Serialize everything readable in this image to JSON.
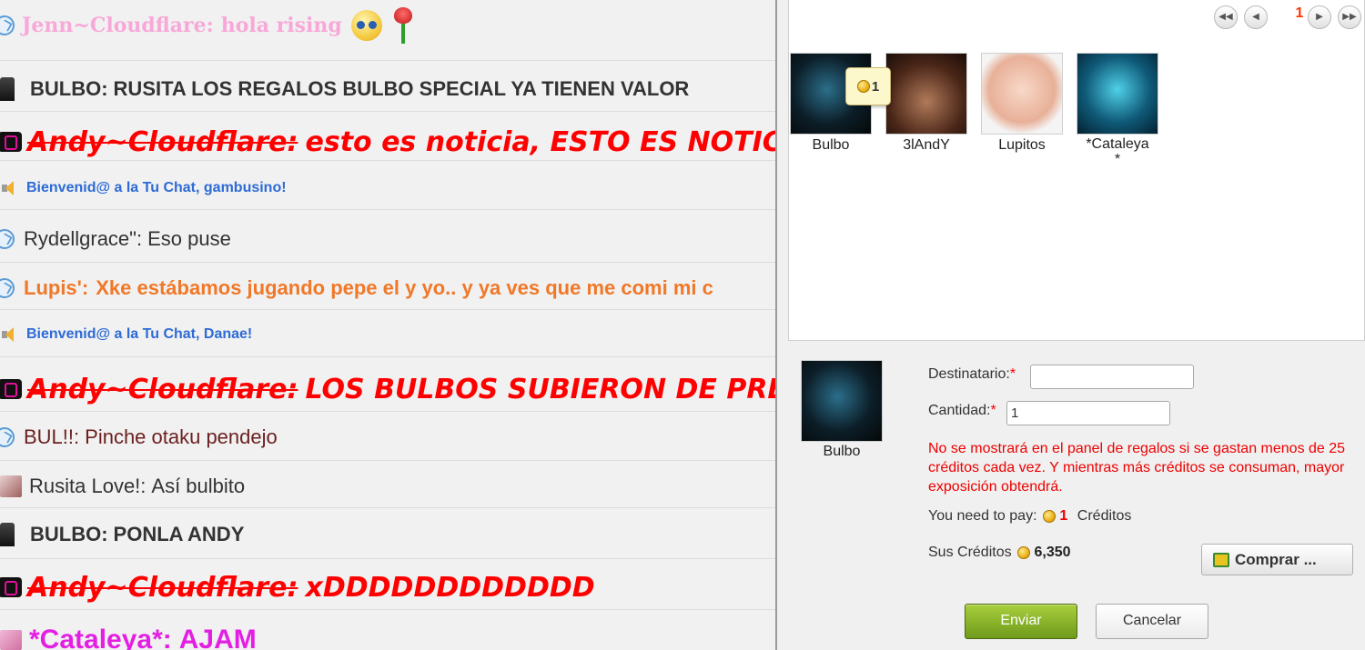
{
  "chat": {
    "messages": [
      {
        "author": "Jenn~Cloudflare:",
        "text": "hola rising"
      },
      {
        "author": "BULBO:",
        "text": "RUSITA LOS REGALOS BULBO SPECIAL YA TIENEN VALOR"
      },
      {
        "author": "Andy~Cloudflare:",
        "text": "esto es noticia, ESTO ES NOTICIA"
      },
      {
        "author": "",
        "text": "Bienvenid@ a la Tu Chat, gambusino!"
      },
      {
        "author": "Rydellgrace\":",
        "text": "Eso puse"
      },
      {
        "author": "Lupis':",
        "text": "Xke estábamos jugando pepe el y yo.. y ya ves que me comi mi c"
      },
      {
        "author": "",
        "text": "Bienvenid@ a la Tu Chat, Danae!"
      },
      {
        "author": "Andy~Cloudflare:",
        "text": "LOS BULBOS SUBIERON DE PRECIO"
      },
      {
        "author": "BUL!!:",
        "text": "Pinche otaku pendejo"
      },
      {
        "author": "Rusita Love!:",
        "text": "Así bulbito"
      },
      {
        "author": "BULBO:",
        "text": "PONLA ANDY"
      },
      {
        "author": "Andy~Cloudflare:",
        "text": "xDDDDDDDDDDDD"
      },
      {
        "author": "*Cataleya*:",
        "text": "AJAM"
      }
    ]
  },
  "gift_dialog": {
    "pagination": {
      "current_page": "1"
    },
    "recipients": [
      {
        "name": "Bulbo"
      },
      {
        "name": "3lAndY"
      },
      {
        "name": "Lupitos"
      },
      {
        "name": "*Cataleya\n*"
      }
    ],
    "gift_count_badge": "1",
    "selected_user": "Bulbo",
    "form": {
      "recipient_label": "Destinatario:",
      "recipient_required": "*",
      "recipient_value": "",
      "quantity_label": "Cantidad:",
      "quantity_required": "*",
      "quantity_value": "1",
      "notice": "No se mostrará en el panel de regalos si se gastan menos de 25 créditos cada vez. Y mientras más créditos se consuman, mayor exposición obtendrá.",
      "pay_label": "You need to pay:",
      "pay_amount": "1",
      "pay_unit": "Créditos",
      "balance_label": "Sus Créditos",
      "balance_amount": "6,350"
    },
    "buttons": {
      "buy": "Comprar ...",
      "send": "Enviar",
      "cancel": "Cancelar"
    },
    "colors": {
      "send_green": "#7fa828",
      "required_red": "#ff0000",
      "page_number": "#ff3300"
    }
  }
}
